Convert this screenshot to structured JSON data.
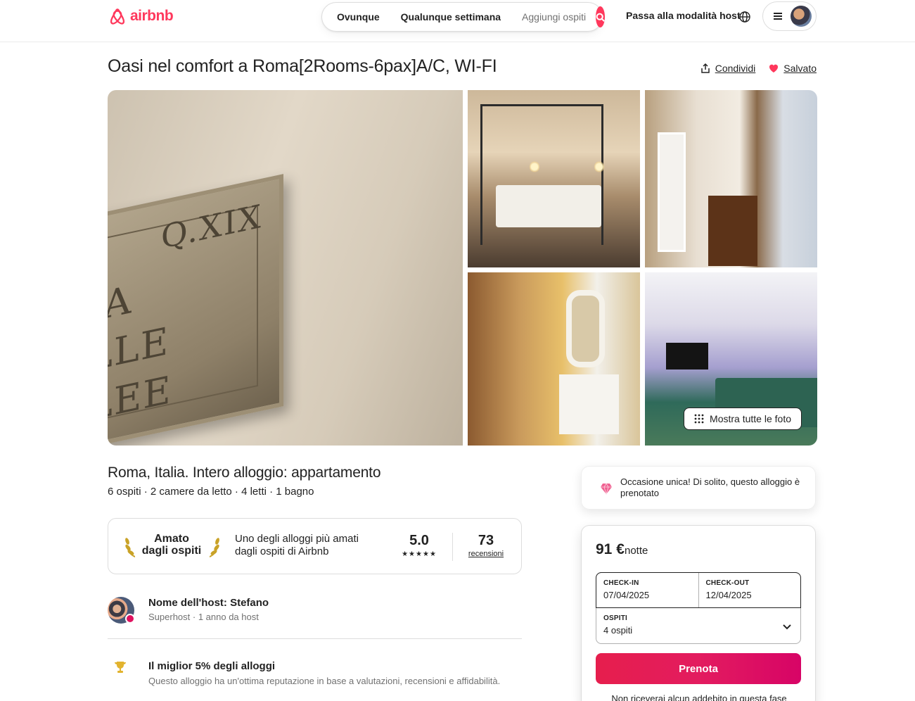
{
  "header": {
    "brand": "airbnb",
    "search": {
      "where": "Ovunque",
      "when": "Qualunque settimana",
      "who": "Aggiungi ospiti"
    },
    "host_mode": "Passa alla modalità host",
    "icons": {
      "logo": "airbnb-logo-icon",
      "search": "search-icon",
      "globe": "globe-icon",
      "menu": "hamburger-menu-icon"
    }
  },
  "listing": {
    "title": "Oasi nel comfort a Roma[2Rooms-6pax]A/C, WI-FI",
    "share": "Condividi",
    "saved": "Salvato",
    "show_all_photos": "Mostra tutte le foto",
    "plaque_text": [
      "Q.XIX",
      "IA",
      "LLE",
      "LEE"
    ],
    "location_title": "Roma, Italia. Intero alloggio: appartamento",
    "specs": "6 ospiti · 2 camere da letto · 4 letti · 1 bagno",
    "guest_fav": {
      "title": "Amato dagli ospiti",
      "description": "Uno degli alloggi più amati dagli ospiti di Airbnb",
      "rating": "5.0",
      "stars": "★★★★★",
      "reviews_count": "73",
      "reviews_label": "recensioni"
    },
    "host": {
      "name": "Nome dell'host: Stefano",
      "sub": "Superhost · 1 anno da host"
    },
    "highlight": {
      "title": "Il miglior 5% degli alloggi",
      "text": "Questo alloggio ha un'ottima reputazione in base a valutazioni, recensioni e affidabilità."
    }
  },
  "booking": {
    "rare_find": "Occasione unica! Di solito, questo alloggio è prenotato",
    "price": "91 €",
    "per_night": "notte",
    "checkin_label": "CHECK-IN",
    "checkin": "07/04/2025",
    "checkout_label": "CHECK-OUT",
    "checkout": "12/04/2025",
    "guests_label": "OSPITI",
    "guests": "4 ospiti",
    "reserve": "Prenota",
    "note": "Non riceverai alcun addebito in questa fase"
  },
  "colors": {
    "brand": "#ff385c",
    "cta_start": "#e61e4d",
    "cta_end": "#d70466"
  }
}
